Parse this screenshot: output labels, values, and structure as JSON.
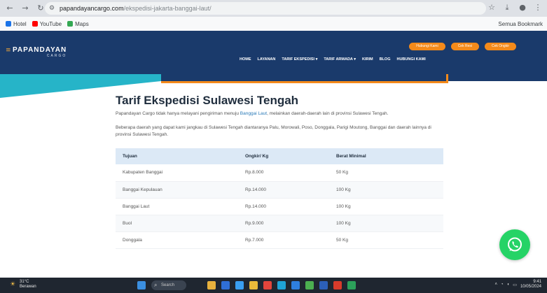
{
  "browser": {
    "url_host": "papandayancargo.com",
    "url_path": "/ekspedisi-jakarta-banggai-laut/",
    "bookmarks": [
      {
        "label": "Hotel",
        "color": "#1a73e8"
      },
      {
        "label": "YouTube",
        "color": "#ff0000"
      },
      {
        "label": "Maps",
        "color": "#34a853"
      }
    ],
    "bookmarks_right": "Semua Bookmark"
  },
  "site": {
    "logo_main": "PAPANDAYAN",
    "logo_sub": "CARGO",
    "top_buttons": [
      "Hubungi Kami",
      "Cek Resi",
      "Cek Ongkir"
    ],
    "nav": [
      "HOME",
      "LAYANAN",
      "TARIF EKSPEDISI ▾",
      "TARIF ARMADA ▾",
      "KIRIM",
      "BLOG",
      "HUBUNGI KAMI"
    ]
  },
  "content": {
    "title": "Tarif Ekspedisi Sulawesi Tengah",
    "para1_pre": "Papandayan Cargo tidak hanya melayani pengiriman menuju ",
    "para1_link": "Banggai Laut",
    "para1_post": ", melainkan daerah-daerah lain di provinsi Sulawesi Tengah.",
    "para2": "Beberapa daerah yang dapat kami jangkau di Sulawesi Tengah diantaranya Palu, Morowali, Poso, Donggala, Parigi Moutong, Banggai dan daerah lainnya di provinsi Sulawesi Tengah.",
    "table": {
      "headers": [
        "Tujuan",
        "Ongkir/ Kg",
        "Berat Minimal"
      ],
      "rows": [
        [
          "Kabupaten Banggai",
          "Rp.8.000",
          "50 Kg"
        ],
        [
          "Banggai Kepulauan",
          "Rp.14.000",
          "100 Kg"
        ],
        [
          "Banggai Laut",
          "Rp.14.000",
          "100 Kg"
        ],
        [
          "Buol",
          "Rp.9.000",
          "100 Kg"
        ],
        [
          "Donggala",
          "Rp.7.000",
          "50 Kg"
        ]
      ]
    }
  },
  "taskbar": {
    "weather_temp": "31°C",
    "weather_desc": "Berawan",
    "search_label": "Search",
    "time": "9:41",
    "date": "10/05/2024"
  }
}
